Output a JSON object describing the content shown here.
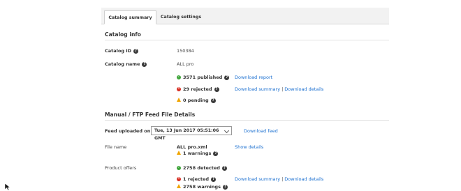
{
  "tabs": [
    {
      "label": "Catalog summary",
      "active": true
    },
    {
      "label": "Catalog settings",
      "active": false
    }
  ],
  "catalog_info": {
    "title": "Catalog info",
    "id_label": "Catalog ID",
    "id_value": "150384",
    "name_label": "Catalog name",
    "name_value": "ALL pro",
    "published": "3571 published",
    "rejected": "29 rejected",
    "pending": "0 pending",
    "download_report": "Download report",
    "download_summary": "Download summary",
    "link_separator": "|",
    "download_details": "Download details"
  },
  "feed": {
    "title": "Manual / FTP Feed File Details",
    "uploaded_label": "Feed uploaded on",
    "uploaded_value": "Tue, 13 Jun 2017 05:51:06 GMT",
    "download_feed": "Download feed",
    "file_name_label": "File name",
    "file_name_value": "ALL pro.xml",
    "file_warnings": "1 warnings",
    "show_details": "Show details",
    "offers_label": "Product offers",
    "detected": "2758 detected",
    "offers_rejected": "1 rejected",
    "offers_warnings": "2758 warnings",
    "download_summary": "Download summary",
    "link_separator": "|",
    "download_details": "Download details"
  },
  "colors": {
    "link": "#1a6fd0",
    "success": "#3fa53a",
    "error": "#d93025",
    "warning": "#f0a500"
  }
}
